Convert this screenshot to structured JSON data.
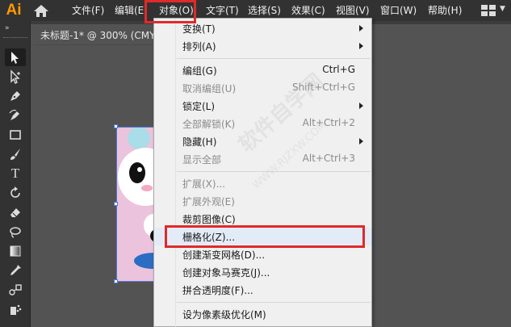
{
  "app": {
    "logo": "Ai"
  },
  "menubar": {
    "items": [
      {
        "label": "文件(F)"
      },
      {
        "label": "编辑(E)"
      },
      {
        "label": "对象(O)"
      },
      {
        "label": "文字(T)"
      },
      {
        "label": "选择(S)"
      },
      {
        "label": "效果(C)"
      },
      {
        "label": "视图(V)"
      },
      {
        "label": "窗口(W)"
      },
      {
        "label": "帮助(H)"
      }
    ],
    "active_item": "对象(O)"
  },
  "document": {
    "tab_title": "未标题-1* @ 300% (CMY"
  },
  "toolbar": {
    "collapse_glyph": "»",
    "tools": [
      {
        "icon": "selection-tool-icon"
      },
      {
        "icon": "direct-selection-tool-icon"
      },
      {
        "icon": "pen-tool-icon"
      },
      {
        "icon": "curvature-tool-icon"
      },
      {
        "icon": "rectangle-tool-icon"
      },
      {
        "icon": "paintbrush-tool-icon"
      },
      {
        "icon": "type-tool-icon",
        "glyph": "T"
      },
      {
        "icon": "rotate-tool-icon"
      },
      {
        "icon": "eraser-tool-icon"
      },
      {
        "icon": "lasso-tool-icon"
      },
      {
        "icon": "gradient-tool-icon"
      },
      {
        "icon": "eyedropper-tool-icon"
      },
      {
        "icon": "blend-tool-icon"
      },
      {
        "icon": "symbol-sprayer-tool-icon"
      }
    ]
  },
  "object_menu": {
    "items": [
      {
        "label": "变换(T)",
        "shortcut": "",
        "submenu": true,
        "disabled": false
      },
      {
        "label": "排列(A)",
        "shortcut": "",
        "submenu": true,
        "disabled": false
      },
      {
        "label": "编组(G)",
        "shortcut": "Ctrl+G",
        "submenu": false,
        "disabled": false
      },
      {
        "label": "取消编组(U)",
        "shortcut": "Shift+Ctrl+G",
        "submenu": false,
        "disabled": true
      },
      {
        "label": "锁定(L)",
        "shortcut": "",
        "submenu": true,
        "disabled": false
      },
      {
        "label": "全部解锁(K)",
        "shortcut": "Alt+Ctrl+2",
        "submenu": false,
        "disabled": true
      },
      {
        "label": "隐藏(H)",
        "shortcut": "",
        "submenu": true,
        "disabled": false
      },
      {
        "label": "显示全部",
        "shortcut": "Alt+Ctrl+3",
        "submenu": false,
        "disabled": true
      },
      {
        "label": "扩展(X)...",
        "shortcut": "",
        "submenu": false,
        "disabled": true
      },
      {
        "label": "扩展外观(E)",
        "shortcut": "",
        "submenu": false,
        "disabled": true
      },
      {
        "label": "裁剪图像(C)",
        "shortcut": "",
        "submenu": false,
        "disabled": false
      },
      {
        "label": "栅格化(Z)...",
        "shortcut": "",
        "submenu": false,
        "disabled": false,
        "highlighted": true
      },
      {
        "label": "创建渐变网格(D)...",
        "shortcut": "",
        "submenu": false,
        "disabled": false
      },
      {
        "label": "创建对象马赛克(J)...",
        "shortcut": "",
        "submenu": false,
        "disabled": false
      },
      {
        "label": "拼合透明度(F)...",
        "shortcut": "",
        "submenu": false,
        "disabled": false
      },
      {
        "label": "设为像素级优化(M)",
        "shortcut": "",
        "submenu": false,
        "disabled": false
      }
    ]
  },
  "watermark": {
    "line1": "软件自学网",
    "line2": "WWW.RJZXW.COM"
  },
  "colors": {
    "accent_ai": "#ff9a00",
    "highlight_box": "#e02a2a",
    "selection_blue": "#4f7ad6",
    "artwork_pink": "#ecc3dc"
  }
}
